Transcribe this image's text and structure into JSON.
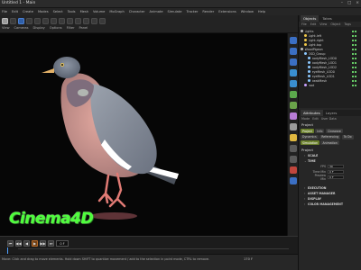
{
  "window": {
    "title": "Untitled 1 - Main",
    "controls": [
      "–",
      "□",
      "×"
    ]
  },
  "menubar": {
    "items": [
      "File",
      "Edit",
      "Create",
      "Modes",
      "Select",
      "Tools",
      "Mesh",
      "Volume",
      "MoGraph",
      "Character",
      "Animate",
      "Simulate",
      "Tracker",
      "Render",
      "Extensions",
      "Window",
      "Help"
    ],
    "right_items": [
      "Standard",
      "Model",
      "Sculpt",
      "UVEdit",
      "Paint",
      "Groom",
      "Track",
      "Script",
      "Nodes"
    ]
  },
  "view_menu": [
    "View",
    "Cameras",
    "Display",
    "Options",
    "Filter",
    "Panel"
  ],
  "brand": {
    "text": "Cinema4D",
    "color": "#4dff3a"
  },
  "timeline": {
    "current_frame": "0 F",
    "buttons": [
      "⏮",
      "◀◀",
      "◀",
      "▶",
      "▶▶",
      "⏭"
    ]
  },
  "status": {
    "text": "Move: Click and drag to move elements. Hold down SHIFT to quantize movement / add to the selection in point mode, CTRL to remove.",
    "frames": "170 F",
    "frames_end": "170 F"
  },
  "objects_panel": {
    "tabs": [
      "Objects",
      "Takes"
    ],
    "menu": [
      "File",
      "Edit",
      "View",
      "Object",
      "Tags",
      "Bookmarks"
    ],
    "items": [
      {
        "label": "Lights",
        "color": "#bbbbbb",
        "indent": 0
      },
      {
        "label": "Light.left",
        "color": "#f0c84a",
        "indent": 1
      },
      {
        "label": "Light.right",
        "color": "#f0c84a",
        "indent": 1
      },
      {
        "label": "Light.top",
        "color": "#f0c84a",
        "indent": 1
      },
      {
        "label": "WoodPigeon",
        "color": "#bbbbbb",
        "indent": 0
      },
      {
        "label": "OSD_Group",
        "color": "#8cc8ff",
        "indent": 1
      },
      {
        "label": "bodyMesh_LOD0",
        "color": "#8cc8ff",
        "indent": 2
      },
      {
        "label": "bodyMesh_LOD1",
        "color": "#8cc8ff",
        "indent": 2
      },
      {
        "label": "bodyMesh_LOD2",
        "color": "#8cc8ff",
        "indent": 2
      },
      {
        "label": "eyeMesh_LOD0",
        "color": "#8cc8ff",
        "indent": 2
      },
      {
        "label": "eyeMesh_LOD1",
        "color": "#8cc8ff",
        "indent": 2
      },
      {
        "label": "beakMesh",
        "color": "#8cc8ff",
        "indent": 2
      },
      {
        "label": "root",
        "color": "#c8a0ff",
        "indent": 1
      }
    ]
  },
  "attributes_panel": {
    "tabs": [
      "Attributes",
      "Layers"
    ],
    "menu": [
      "Mode",
      "Edit",
      "User Data"
    ],
    "title": "Project",
    "chips": [
      "Project",
      "Info",
      "Cineware",
      "Dynamics",
      "Referencing",
      "To Do",
      "Simulation",
      "Animation"
    ],
    "active_chip": "Project",
    "section": "Project",
    "props": [
      {
        "label": "SCALE",
        "type": "hdr"
      },
      {
        "label": "TIME",
        "type": "hdr"
      }
    ],
    "time_fields": [
      {
        "label": "FPS",
        "value": "30"
      },
      {
        "label": "Time Min",
        "value": "0 F"
      },
      {
        "label": "Preview Min",
        "value": "0 F"
      }
    ],
    "more_props": [
      "EXECUTION",
      "ASSET MANAGER",
      "DISPLAY",
      "COLOR MANAGEMENT"
    ]
  }
}
